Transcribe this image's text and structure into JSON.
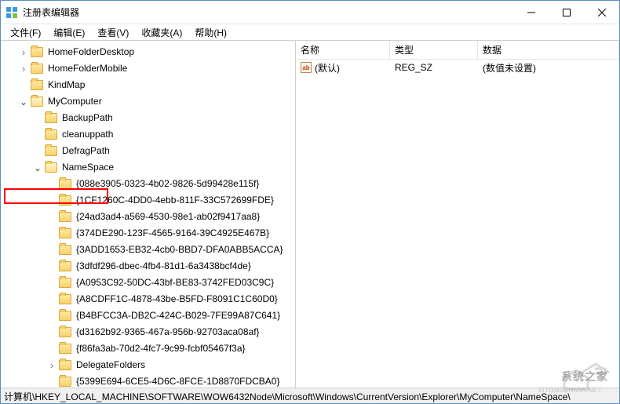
{
  "window": {
    "title": "注册表编辑器"
  },
  "menu": {
    "file": "文件(F)",
    "edit": "编辑(E)",
    "view": "查看(V)",
    "favorites": "收藏夹(A)",
    "help": "帮助(H)"
  },
  "tree": {
    "nodes": [
      {
        "indent": 1,
        "exp": "closed",
        "label": "HomeFolderDesktop"
      },
      {
        "indent": 1,
        "exp": "closed",
        "label": "HomeFolderMobile"
      },
      {
        "indent": 1,
        "exp": "none",
        "label": "KindMap"
      },
      {
        "indent": 1,
        "exp": "open",
        "label": "MyComputer",
        "open": true
      },
      {
        "indent": 2,
        "exp": "none",
        "label": "BackupPath"
      },
      {
        "indent": 2,
        "exp": "none",
        "label": "cleanuppath"
      },
      {
        "indent": 2,
        "exp": "none",
        "label": "DefragPath"
      },
      {
        "indent": 2,
        "exp": "open",
        "label": "NameSpace",
        "open": true
      },
      {
        "indent": 3,
        "exp": "none",
        "label": "{088e3905-0323-4b02-9826-5d99428e115f}"
      },
      {
        "indent": 3,
        "exp": "none",
        "label": "{1CF1260C-4DD0-4ebb-811F-33C572699FDE}"
      },
      {
        "indent": 3,
        "exp": "none",
        "label": "{24ad3ad4-a569-4530-98e1-ab02f9417aa8}"
      },
      {
        "indent": 3,
        "exp": "none",
        "label": "{374DE290-123F-4565-9164-39C4925E467B}"
      },
      {
        "indent": 3,
        "exp": "none",
        "label": "{3ADD1653-EB32-4cb0-BBD7-DFA0ABB5ACCA}"
      },
      {
        "indent": 3,
        "exp": "none",
        "label": "{3dfdf296-dbec-4fb4-81d1-6a3438bcf4de}"
      },
      {
        "indent": 3,
        "exp": "none",
        "label": "{A0953C92-50DC-43bf-BE83-3742FED03C9C}"
      },
      {
        "indent": 3,
        "exp": "none",
        "label": "{A8CDFF1C-4878-43be-B5FD-F8091C1C60D0}"
      },
      {
        "indent": 3,
        "exp": "none",
        "label": "{B4BFCC3A-DB2C-424C-B029-7FE99A87C641}"
      },
      {
        "indent": 3,
        "exp": "none",
        "label": "{d3162b92-9365-467a-956b-92703aca08af}"
      },
      {
        "indent": 3,
        "exp": "none",
        "label": "{f86fa3ab-70d2-4fc7-9c99-fcbf05467f3a}"
      },
      {
        "indent": 3,
        "exp": "closed",
        "label": "DelegateFolders"
      },
      {
        "indent": 3,
        "exp": "none",
        "label": "{5399E694-6CE5-4D6C-8FCE-1D8870FDCBA0}"
      }
    ]
  },
  "list": {
    "columns": {
      "name": "名称",
      "type": "类型",
      "data": "数据"
    },
    "rows": [
      {
        "icon": "ab",
        "name": "(默认)",
        "type": "REG_SZ",
        "data": "(数值未设置)"
      }
    ]
  },
  "statusbar": {
    "path": "计算机\\HKEY_LOCAL_MACHINE\\SOFTWARE\\WOW6432Node\\Microsoft\\Windows\\CurrentVersion\\Explorer\\MyComputer\\NameSpace\\"
  },
  "watermark": {
    "text": "系统之家",
    "sub": "XITONGZHIJIA.NET"
  }
}
